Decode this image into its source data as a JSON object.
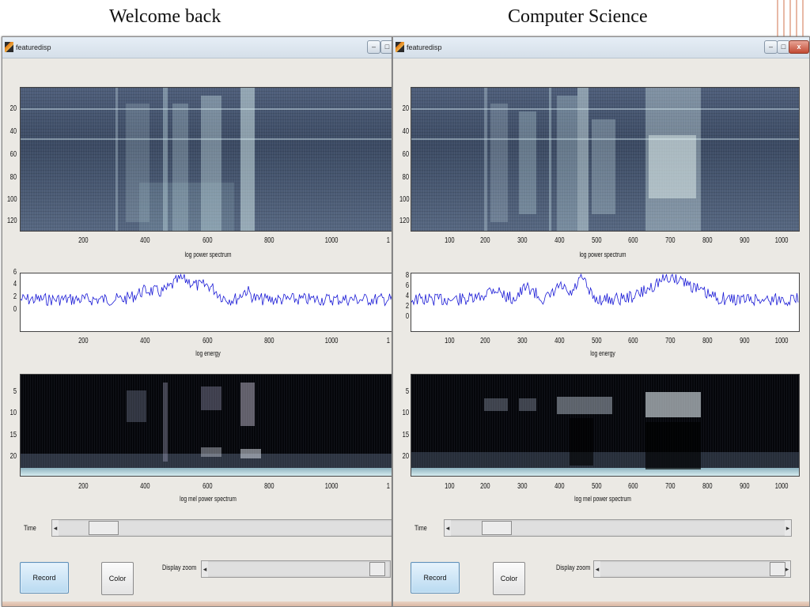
{
  "slide": {
    "left_title": "Welcome back",
    "right_title": "Computer Science"
  },
  "windows": [
    {
      "title": "featuredisp",
      "spectrum_label": "log power spectrum",
      "energy_label": "log energy",
      "mel_label": "log mel power spectrum",
      "x_ticks": [
        "200",
        "400",
        "600",
        "800",
        "1000",
        "1"
      ],
      "spec_y_ticks": [
        "20",
        "40",
        "60",
        "80",
        "100",
        "120"
      ],
      "energy_y_ticks": [
        "6",
        "4",
        "2",
        "0"
      ],
      "mel_y_ticks": [
        "5",
        "10",
        "15",
        "20"
      ],
      "time_label": "Time",
      "time_slider_value": 0.1,
      "zoom_label": "Display zoom",
      "zoom_slider_value": 1.0,
      "record_label": "Record",
      "color_label": "Color"
    },
    {
      "title": "featuredisp",
      "spectrum_label": "log power spectrum",
      "energy_label": "log energy",
      "mel_label": "log mel power spectrum",
      "x_ticks": [
        "100",
        "200",
        "300",
        "400",
        "500",
        "600",
        "700",
        "800",
        "900",
        "1000"
      ],
      "spec_y_ticks": [
        "20",
        "40",
        "60",
        "80",
        "100",
        "120"
      ],
      "energy_y_ticks": [
        "8",
        "6",
        "4",
        "2",
        "0"
      ],
      "mel_y_ticks": [
        "5",
        "10",
        "15",
        "20"
      ],
      "time_label": "Time",
      "time_slider_value": 0.1,
      "zoom_label": "Display zoom",
      "zoom_slider_value": 1.0,
      "record_label": "Record",
      "color_label": "Color"
    }
  ],
  "colors": {
    "energy_trace": "#1a1ad6",
    "window_bg": "#ebe9e4",
    "record_button": "#b9daf1"
  },
  "icons": [
    "matlab-figure-icon",
    "minimize-icon",
    "maximize-icon",
    "close-icon",
    "arrow-left-icon",
    "arrow-right-icon"
  ]
}
